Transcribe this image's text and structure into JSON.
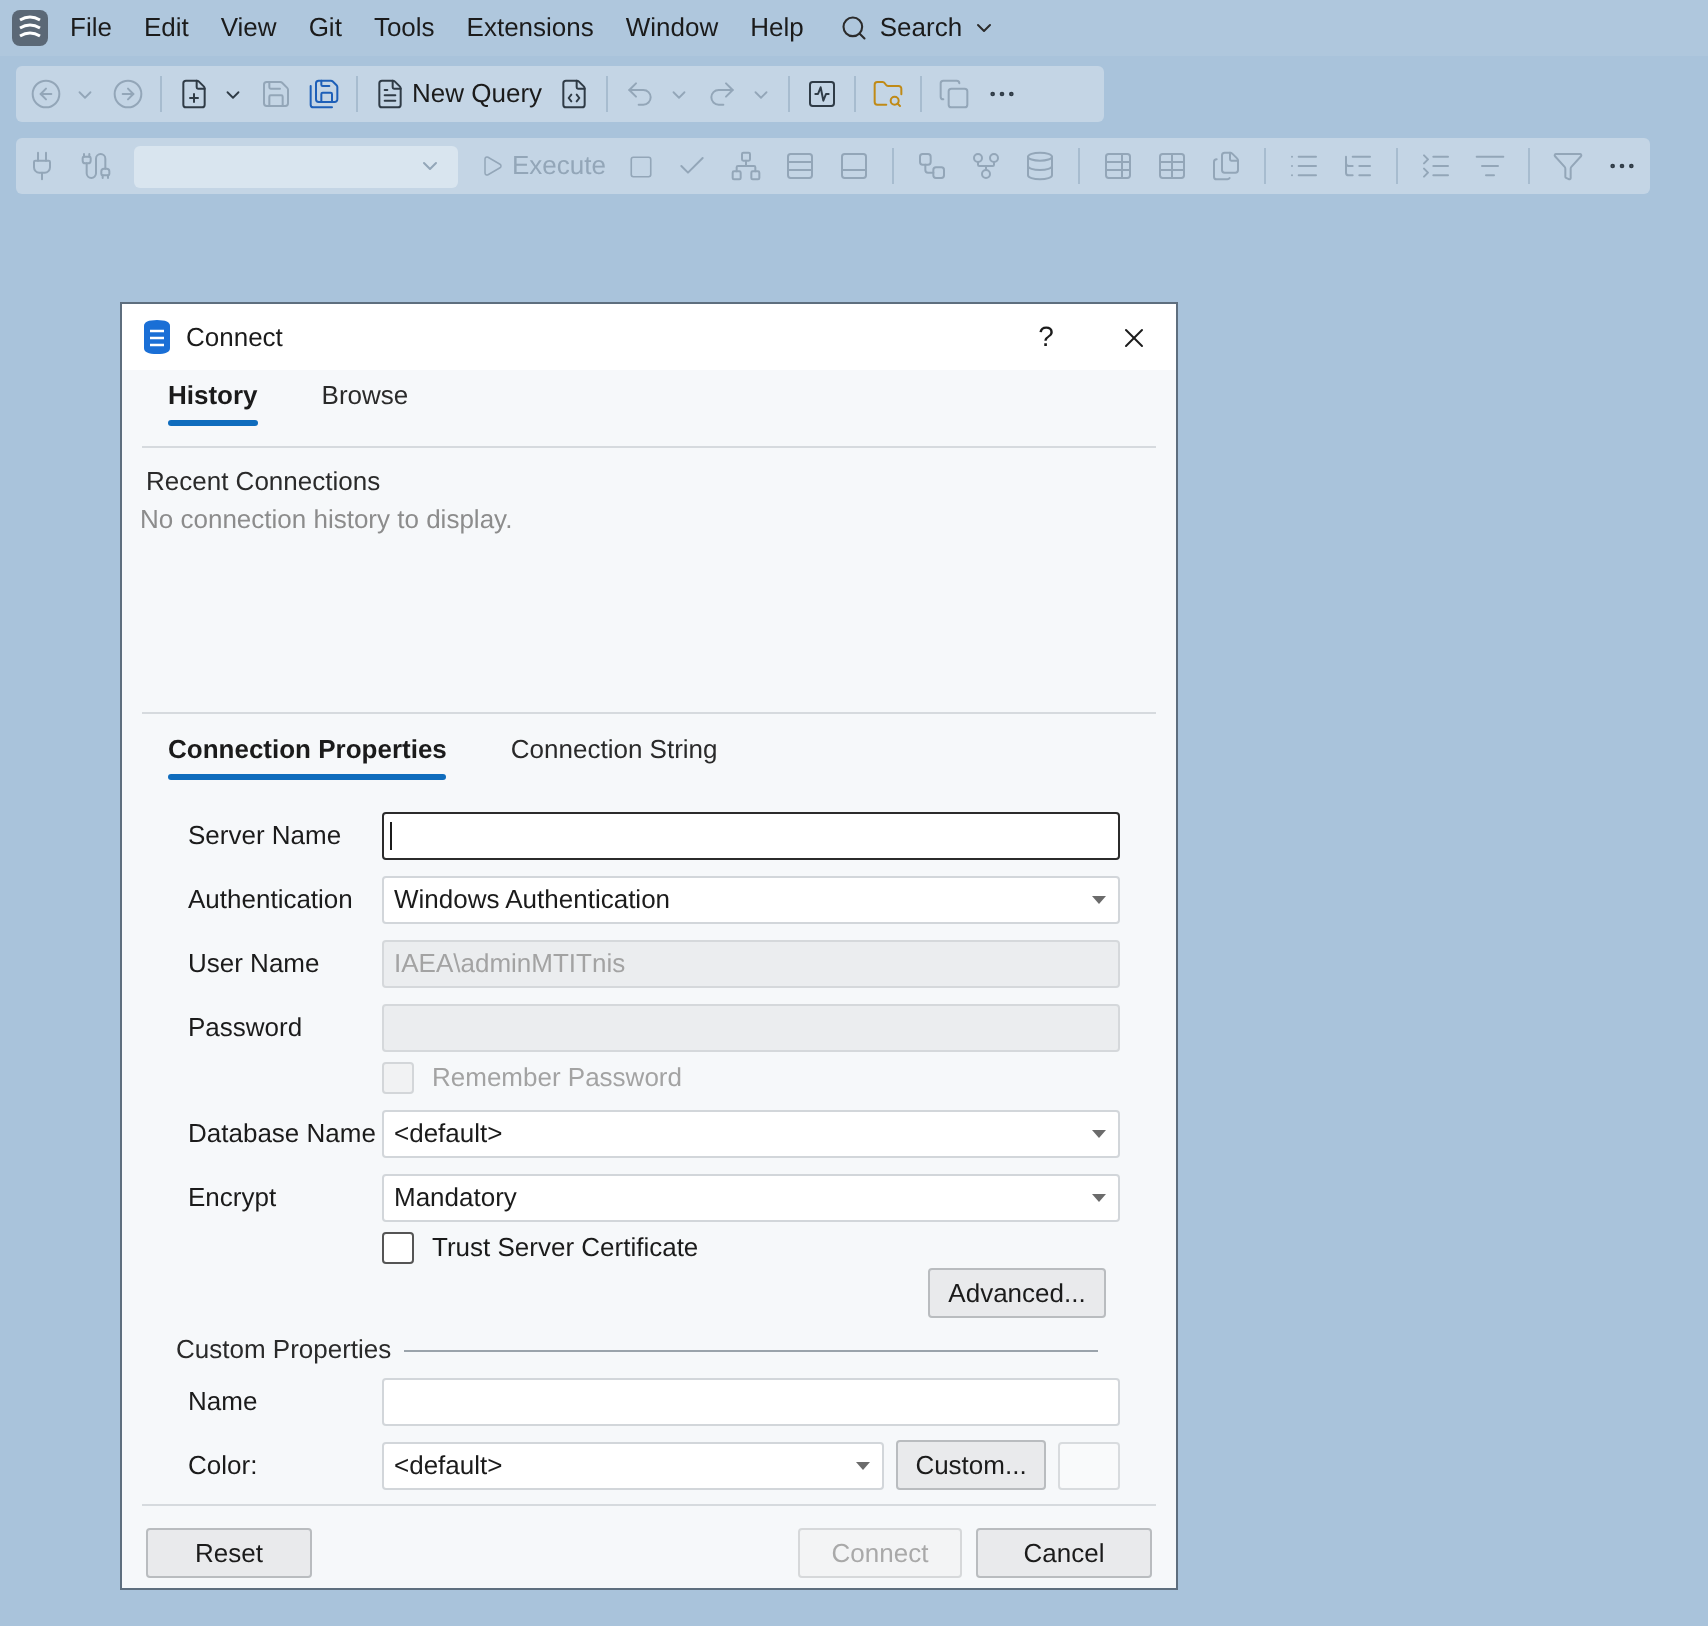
{
  "menu": {
    "items": [
      "File",
      "Edit",
      "View",
      "Git",
      "Tools",
      "Extensions",
      "Window",
      "Help"
    ],
    "search": {
      "label": "Search"
    }
  },
  "toolbar": {
    "new_query": {
      "label": "New Query",
      "disabled": false
    },
    "execute": {
      "label": "Execute",
      "disabled": true
    }
  },
  "dialog": {
    "title": "Connect",
    "help_label": "?",
    "top_tabs": [
      {
        "label": "History",
        "selected": true
      },
      {
        "label": "Browse",
        "selected": false
      }
    ],
    "recent": {
      "heading": "Recent Connections",
      "empty_message": "No connection history to display."
    },
    "property_tabs": [
      {
        "label": "Connection Properties",
        "selected": true
      },
      {
        "label": "Connection String",
        "selected": false
      }
    ],
    "fields": [
      {
        "kind": "text",
        "label": "Server Name",
        "focused": true,
        "disabled": false
      },
      {
        "kind": "select",
        "label": "Authentication",
        "value": "Windows Authentication",
        "focused": false,
        "disabled": false
      },
      {
        "kind": "text",
        "label": "User Name",
        "value": "IAEA\\adminMTITnis",
        "focused": false,
        "disabled": true
      },
      {
        "kind": "text",
        "label": "Password",
        "focused": false,
        "disabled": true
      },
      {
        "kind": "checkbox",
        "label": "Remember Password",
        "checked": false,
        "disabled": true
      },
      {
        "kind": "select",
        "label": "Database Name",
        "value": "<default>",
        "focused": false,
        "disabled": false
      },
      {
        "kind": "select",
        "label": "Encrypt",
        "value": "Mandatory",
        "focused": false,
        "disabled": false
      },
      {
        "kind": "checkbox",
        "label": "Trust Server Certificate",
        "checked": false,
        "disabled": false
      }
    ],
    "advanced_button": "Advanced...",
    "custom_properties": {
      "heading": "Custom Properties",
      "name": {
        "label": "Name"
      },
      "color": {
        "label": "Color:",
        "value": "<default>",
        "custom_button": "Custom..."
      }
    },
    "buttons": [
      {
        "label": "Reset",
        "disabled": false
      },
      {
        "label": "Connect",
        "disabled": true
      },
      {
        "label": "Cancel",
        "disabled": false
      }
    ]
  }
}
